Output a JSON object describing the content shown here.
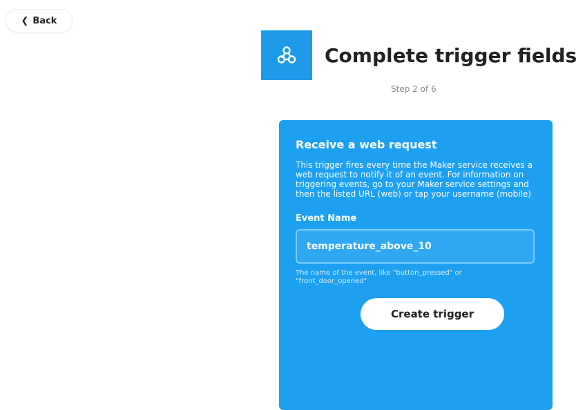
{
  "nav": {
    "back_label": "Back",
    "back_icon": "chevron-left-icon"
  },
  "header": {
    "service_icon": "webhook-icon",
    "service_color": "#1e9be8",
    "title": "Complete trigger fields",
    "step": "Step 2 of 6"
  },
  "card": {
    "color": "#1ea0f0",
    "title": "Receive a web request",
    "description": "This trigger fires every time the Maker service receives a web request to notify it of an event. For information on triggering events, go to your Maker service settings and then the listed URL (web) or tap your username (mobile)",
    "field": {
      "label": "Event Name",
      "value": "temperature_above_10",
      "help": "The name of the event, like \"button_pressed\" or \"front_door_opened\""
    },
    "submit_label": "Create trigger"
  }
}
